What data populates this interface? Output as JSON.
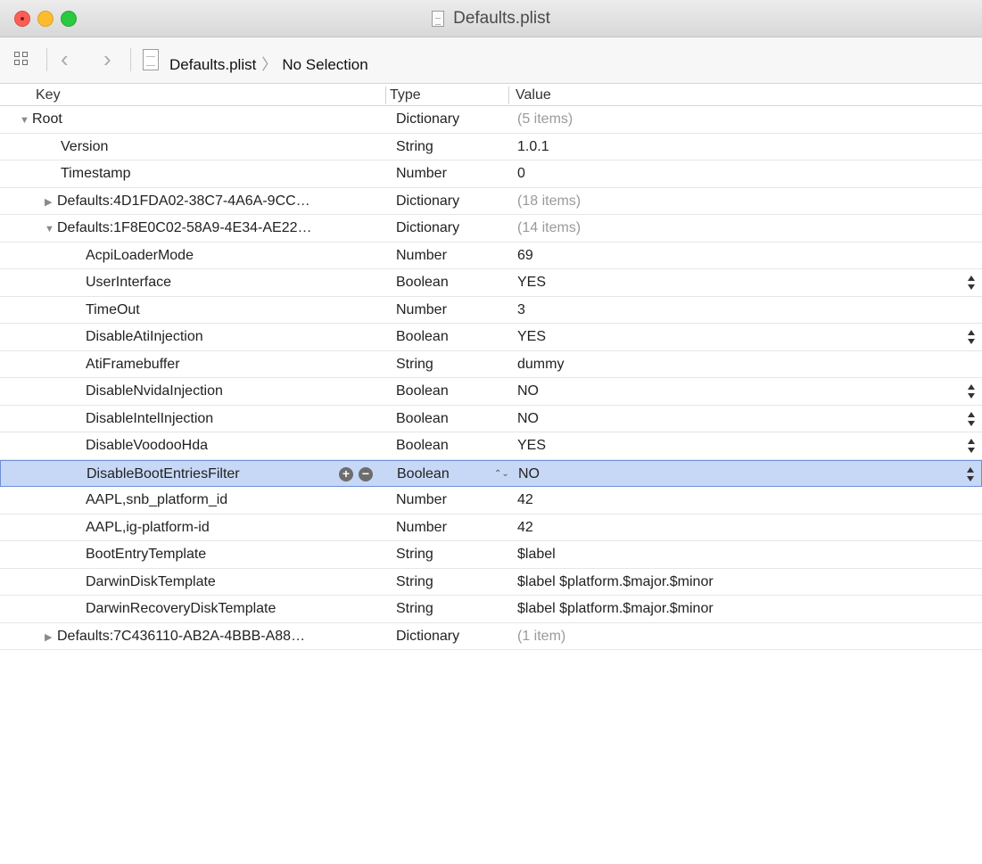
{
  "window": {
    "title": "Defaults.plist"
  },
  "jumpbar": {
    "file": "Defaults.plist",
    "selection": "No Selection"
  },
  "columns": {
    "key": "Key",
    "type": "Type",
    "value": "Value"
  },
  "rows": [
    {
      "key": "Root",
      "type": "Dictionary",
      "value": "(5 items)",
      "indent": 0,
      "disclosure": "expanded",
      "count": true
    },
    {
      "key": "Version",
      "type": "String",
      "value": "1.0.1",
      "indent": 1
    },
    {
      "key": "Timestamp",
      "type": "Number",
      "value": "0",
      "indent": 1
    },
    {
      "key": "Defaults:4D1FDA02-38C7-4A6A-9CC…",
      "type": "Dictionary",
      "value": "(18 items)",
      "indent": 1,
      "disclosure": "collapsed",
      "count": true
    },
    {
      "key": "Defaults:1F8E0C02-58A9-4E34-AE22…",
      "type": "Dictionary",
      "value": "(14 items)",
      "indent": 1,
      "disclosure": "expanded",
      "count": true
    },
    {
      "key": "AcpiLoaderMode",
      "type": "Number",
      "value": "69",
      "indent": 2
    },
    {
      "key": "UserInterface",
      "type": "Boolean",
      "value": "YES",
      "indent": 2,
      "stepper": true
    },
    {
      "key": "TimeOut",
      "type": "Number",
      "value": "3",
      "indent": 2
    },
    {
      "key": "DisableAtiInjection",
      "type": "Boolean",
      "value": "YES",
      "indent": 2,
      "stepper": true
    },
    {
      "key": "AtiFramebuffer",
      "type": "String",
      "value": "dummy",
      "indent": 2
    },
    {
      "key": "DisableNvidaInjection",
      "type": "Boolean",
      "value": "NO",
      "indent": 2,
      "stepper": true
    },
    {
      "key": "DisableIntelInjection",
      "type": "Boolean",
      "value": "NO",
      "indent": 2,
      "stepper": true
    },
    {
      "key": "DisableVoodooHda",
      "type": "Boolean",
      "value": "YES",
      "indent": 2,
      "stepper": true
    },
    {
      "key": "DisableBootEntriesFilter",
      "type": "Boolean",
      "value": "NO",
      "indent": 2,
      "stepper": true,
      "selected": true
    },
    {
      "key": "AAPL,snb_platform_id",
      "type": "Number",
      "value": "42",
      "indent": 2
    },
    {
      "key": "AAPL,ig-platform-id",
      "type": "Number",
      "value": "42",
      "indent": 2
    },
    {
      "key": "BootEntryTemplate",
      "type": "String",
      "value": "$label",
      "indent": 2
    },
    {
      "key": "DarwinDiskTemplate",
      "type": "String",
      "value": "$label $platform.$major.$minor",
      "indent": 2
    },
    {
      "key": "DarwinRecoveryDiskTemplate",
      "type": "String",
      "value": "$label $platform.$major.$minor",
      "indent": 2
    },
    {
      "key": "Defaults:7C436110-AB2A-4BBB-A88…",
      "type": "Dictionary",
      "value": "(1 item)",
      "indent": 1,
      "disclosure": "collapsed",
      "count": true
    }
  ]
}
